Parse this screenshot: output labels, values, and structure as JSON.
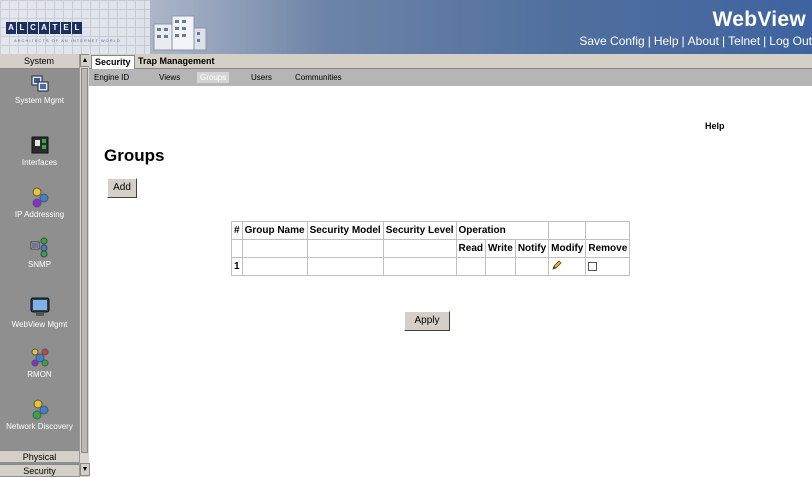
{
  "header": {
    "app_title": "WebView",
    "logo_text": "ALCATEL",
    "logo_tagline": "ARCHITECTS OF AN INTERNET WORLD",
    "links": [
      "Save Config",
      "Help",
      "About",
      "Telnet",
      "Log Out"
    ]
  },
  "sidebar": {
    "header_label": "System",
    "items": [
      {
        "label": "System Mgmt",
        "icon": "system-mgmt-icon"
      },
      {
        "label": "Interfaces",
        "icon": "interfaces-icon"
      },
      {
        "label": "IP Addressing",
        "icon": "ip-addressing-icon"
      },
      {
        "label": "SNMP",
        "icon": "snmp-icon"
      },
      {
        "label": "WebView Mgmt",
        "icon": "webview-mgmt-icon"
      },
      {
        "label": "RMON",
        "icon": "rmon-icon"
      },
      {
        "label": "Network Discovery",
        "icon": "network-discovery-icon"
      }
    ],
    "bottom_items": [
      "Physical",
      "Security"
    ]
  },
  "tabs": [
    "Security",
    "Trap Management"
  ],
  "subtabs": [
    "Engine ID",
    "Views",
    "Groups",
    "Users",
    "Communities"
  ],
  "active_subtab": "Groups",
  "page": {
    "help_label": "Help",
    "title": "Groups",
    "add_label": "Add",
    "apply_label": "Apply"
  },
  "table": {
    "headers": [
      "#",
      "Group Name",
      "Security Model",
      "Security Level",
      "Operation",
      "",
      ""
    ],
    "subheaders": [
      "Read",
      "Write",
      "Notify",
      "Modify",
      "Remove"
    ],
    "rows": [
      {
        "num": "1",
        "group_name": "",
        "security_model": "",
        "security_level": "",
        "read": "",
        "write": "",
        "notify": ""
      }
    ]
  }
}
